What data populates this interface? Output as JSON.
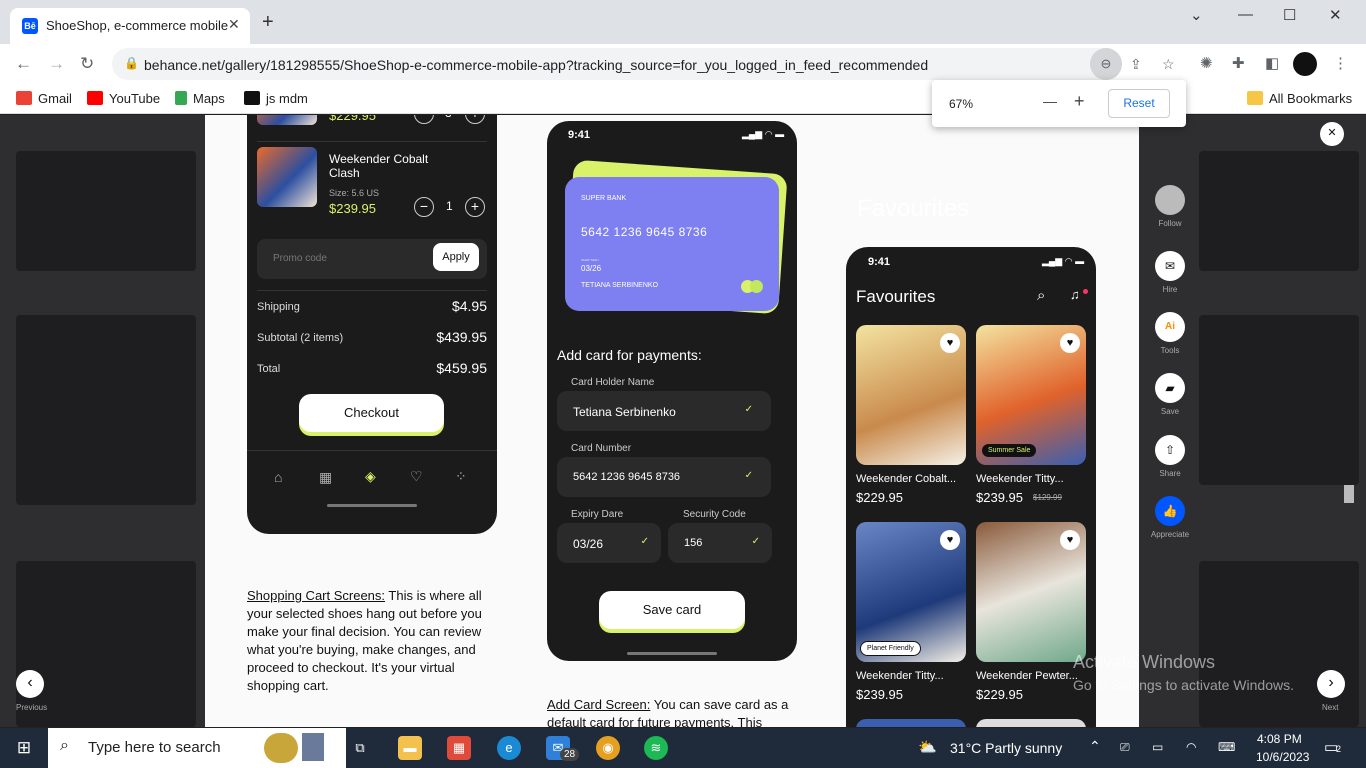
{
  "browser": {
    "tab_title": "ShoeShop, e-commerce mobile",
    "favicon_text": "Bē",
    "url": "behance.net/gallery/181298555/ShoeShop-e-commerce-mobile-app?tracking_source=for_you_logged_in_feed_recommended",
    "bookmarks": [
      {
        "label": "Gmail",
        "color": "#ea4335"
      },
      {
        "label": "YouTube",
        "color": "#ff0000"
      },
      {
        "label": "Maps",
        "color": "#34a853"
      },
      {
        "label": "js mdm",
        "color": "#111111"
      }
    ],
    "all_bookmarks": "All Bookmarks",
    "zoom": {
      "value": "67%",
      "minus": "—",
      "plus": "+",
      "reset": "Reset"
    }
  },
  "cart": {
    "item1": {
      "price": "$229.95",
      "qty": "3"
    },
    "item2": {
      "name": "Weekender Cobalt Clash",
      "size": "Size: 5.6 US",
      "price": "$239.95",
      "qty": "1"
    },
    "promo_placeholder": "Promo code",
    "apply": "Apply",
    "shipping_label": "Shipping",
    "shipping": "$4.95",
    "subtotal_label": "Subtotal (2 items)",
    "subtotal": "$439.95",
    "total_label": "Total",
    "total": "$459.95",
    "checkout": "Checkout"
  },
  "card_screen": {
    "time": "9:41",
    "bank": "SUPER BANK",
    "number": "5642 1236 9645 8736",
    "valid_label": "VALID THRU",
    "expiry": "03/26",
    "holder": "TETIANA SERBINENKO",
    "heading": "Add card for payments:",
    "holder_label": "Card Holder Name",
    "holder_value": "Tetiana Serbinenko",
    "number_label": "Card Number",
    "number_value": "5642 1236 9645 8736",
    "expiry_label": "Expiry Dare",
    "expiry_value": "03/26",
    "security_label": "Security Code",
    "security_value": "156",
    "save": "Save card"
  },
  "descriptions": {
    "cart_link": "Shopping Cart Screens:",
    "cart_text": " This is where all your selected shoes hang out before you make your final decision. You can review what you're buying, make changes, and proceed to checkout. It's your virtual shopping cart.",
    "card_link": "Add Card Screen:",
    "card_text": " You can save card as a default card for future payments. This"
  },
  "favourites": {
    "section_title": "Favourites",
    "time": "9:41",
    "title": "Favourites",
    "products": [
      {
        "name": "Weekender Cobalt...",
        "price": "$229.95",
        "old": "",
        "badge": ""
      },
      {
        "name": "Weekender Titty...",
        "price": "$239.95",
        "old": "$129.99",
        "badge": "Summer Sale"
      },
      {
        "name": "Weekender Titty...",
        "price": "$239.95",
        "old": "",
        "badge": "Planet Friendly"
      },
      {
        "name": "Weekender Pewter...",
        "price": "$229.95",
        "old": "",
        "badge": ""
      }
    ]
  },
  "behance_sidebar": {
    "follow": "Follow",
    "hire": "Hire",
    "tools": "Tools",
    "save": "Save",
    "share": "Share",
    "appreciate": "Appreciate",
    "previous": "Previous",
    "next": "Next"
  },
  "watermark": {
    "line1": "Activate Windows",
    "line2": "Go to Settings to activate Windows."
  },
  "taskbar": {
    "search_placeholder": "Type here to search",
    "mail_badge": "28",
    "weather": "31°C  Partly sunny",
    "time": "4:08 PM",
    "date": "10/6/2023",
    "notifications": "2"
  }
}
